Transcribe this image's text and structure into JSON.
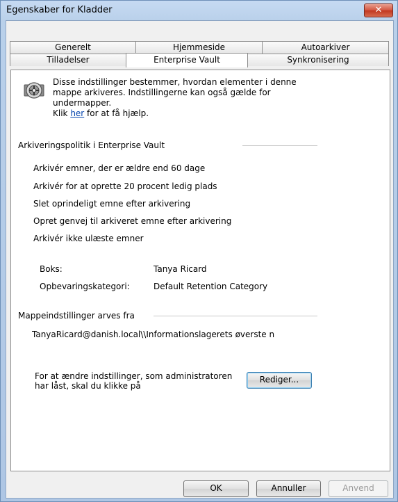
{
  "window": {
    "title": "Egenskaber for Kladder",
    "close_glyph": "✕"
  },
  "tabs": {
    "row1": [
      {
        "label": "Generelt"
      },
      {
        "label": "Hjemmeside"
      },
      {
        "label": "Autoarkiver"
      }
    ],
    "row2": [
      {
        "label": "Tilladelser"
      },
      {
        "label": "Enterprise Vault"
      },
      {
        "label": "Synkronisering"
      }
    ],
    "active": "Enterprise Vault"
  },
  "intro": {
    "text": "Disse indstillinger bestemmer, hvordan elementer i denne mappe arkiveres. Indstillingerne kan også gælde for undermapper.",
    "help_prefix": "Klik ",
    "help_link": "her",
    "help_suffix": " for at få hjælp."
  },
  "policy": {
    "title": "Arkiveringspolitik i Enterprise Vault",
    "rules": [
      "Arkivér emner, der er ældre end 60 dage",
      "Arkivér for at oprette 20 procent ledig plads",
      "Slet oprindeligt emne efter arkivering",
      "Opret genvej til arkiveret emne efter arkivering",
      "Arkivér ikke ulæste emner"
    ],
    "mailbox_label": "Boks:",
    "mailbox_value": "Tanya Ricard",
    "retention_label": "Opbevaringskategori:",
    "retention_value": "Default Retention Category"
  },
  "inherit": {
    "title": "Mappeindstillinger arves fra",
    "path": "TanyaRicard@danish.local\\\\Informationslagerets øverste n"
  },
  "locked": {
    "note": "For at ændre indstillinger, som administratoren har låst, skal du klikke på",
    "edit_button": "Rediger..."
  },
  "footer": {
    "ok": "OK",
    "cancel": "Annuller",
    "apply": "Anvend"
  },
  "colors": {
    "link": "#0645ad",
    "close_button": "#d2543f"
  }
}
